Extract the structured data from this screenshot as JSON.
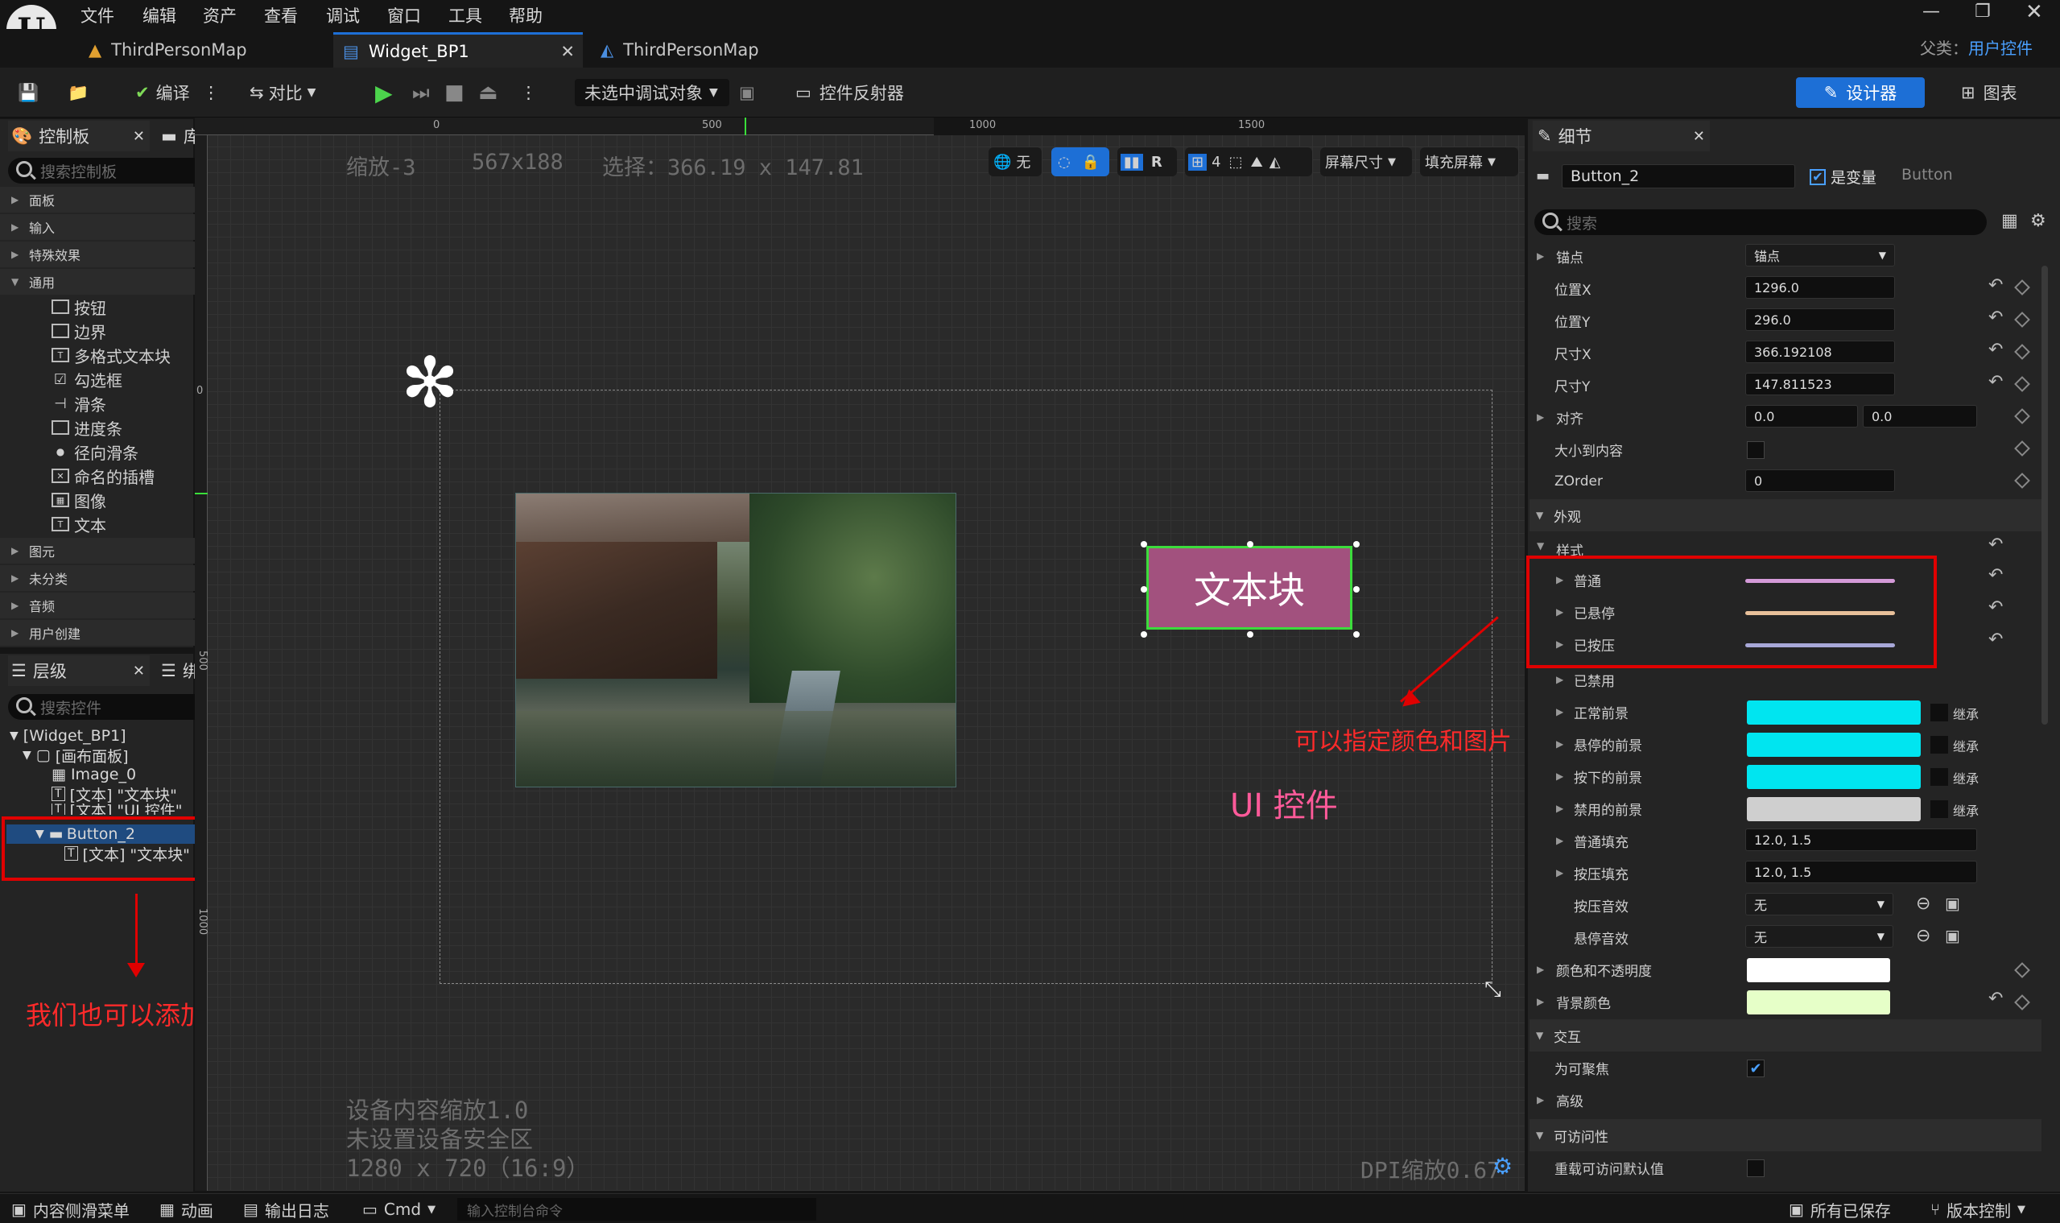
{
  "menu": [
    "文件",
    "编辑",
    "资产",
    "查看",
    "调试",
    "窗口",
    "工具",
    "帮助"
  ],
  "logo": "U",
  "tabs": [
    {
      "label": "ThirdPersonMap"
    },
    {
      "label": "Widget_BP1"
    },
    {
      "label": "ThirdPersonMap"
    }
  ],
  "parent_class": {
    "label": "父类：",
    "value": "用户控件"
  },
  "toolbar": {
    "compile": "编译",
    "diff": "对比",
    "debug_target": "未选中调试对象",
    "widget_reflector": "控件反射器",
    "designer": "设计器",
    "graph": "图表"
  },
  "palette": {
    "title": "控制板",
    "library": "库",
    "search_placeholder": "搜索控制板",
    "categories": [
      "面板",
      "输入",
      "特殊效果",
      "通用"
    ],
    "common_items": [
      "按钮",
      "边界",
      "多格式文本块",
      "勾选框",
      "滑条",
      "进度条",
      "径向滑条",
      "命名的插槽",
      "图像",
      "文本"
    ],
    "more_categories": [
      "图元",
      "未分类",
      "音频",
      "用户创建"
    ]
  },
  "hierarchy": {
    "title": "层级",
    "bind": "绑定控件",
    "search_placeholder": "搜索控件",
    "rows": [
      "[Widget_BP1]",
      "[画布面板]",
      "Image_0",
      "[文本] \"文本块\"",
      "[文本] \"UI 控件\"",
      "Button_2",
      "[文本] \"文本块\""
    ]
  },
  "viewport": {
    "zoom": "缩放-3",
    "size": "567x188",
    "selection": "选择：366.19 x 147.81",
    "ruler_top": [
      "0",
      "500",
      "1000",
      "1500"
    ],
    "ruler_left": [
      "0",
      "500",
      "1000"
    ],
    "tools": {
      "none": "无",
      "r": "R",
      "grid": "4",
      "screen_size": "屏幕尺寸",
      "fill_screen": "填充屏幕"
    },
    "button_text": "文本块",
    "ui_text": "UI 控件",
    "device_scale": "设备内容缩放1.0",
    "safe_zone": "未设置设备安全区",
    "resolution": "1280 x 720（16:9）",
    "dpi": "DPI缩放0.67"
  },
  "details": {
    "title": "细节",
    "name": "Button_2",
    "is_variable": "是变量",
    "class": "Button",
    "search_placeholder": "搜索",
    "anchor": {
      "label": "锚点",
      "value": "锚点"
    },
    "position_x": {
      "label": "位置X",
      "value": "1296.0"
    },
    "position_y": {
      "label": "位置Y",
      "value": "296.0"
    },
    "size_x": {
      "label": "尺寸X",
      "value": "366.192108"
    },
    "size_y": {
      "label": "尺寸Y",
      "value": "147.811523"
    },
    "alignment": {
      "label": "对齐",
      "v1": "0.0",
      "v2": "0.0"
    },
    "size_to_content": "大小到内容",
    "zorder": {
      "label": "ZOrder",
      "value": "0"
    },
    "appearance": "外观",
    "style": "样式",
    "normal": "普通",
    "hovered": "已悬停",
    "pressed": "已按压",
    "disabled": "已禁用",
    "normal_fg": "正常前景",
    "hovered_fg": "悬停的前景",
    "pressed_fg": "按下的前景",
    "disabled_fg": "禁用的前景",
    "inherit": "继承",
    "normal_padding": {
      "label": "普通填充",
      "value": "12.0, 1.5"
    },
    "pressed_padding": {
      "label": "按压填充",
      "value": "12.0, 1.5"
    },
    "pressed_sound": {
      "label": "按压音效",
      "value": "无"
    },
    "hovered_sound": {
      "label": "悬停音效",
      "value": "无"
    },
    "color_opacity": "颜色和不透明度",
    "bg_color": "背景颜色",
    "interaction": "交互",
    "focusable": "为可聚焦",
    "advanced": "高级",
    "accessibility": "可访问性",
    "override_access": "重载可访问默认值"
  },
  "colors": {
    "accent": "#1d6fd6",
    "cyan": "#00e5f0",
    "normal_line": "#d49ad8",
    "hovered_line": "#e8c09a",
    "pressed_line": "#a8a8d8",
    "button_fill": "#a2517e",
    "color_opacity": "#ffffff",
    "bg_color": "#e6ffc8",
    "annotation": "#ff2a2a"
  },
  "annotations": {
    "colors_images": "可以指定颜色和图片",
    "child_widgets": "我们也可以添加子控件"
  },
  "statusbar": {
    "content_drawer": "内容侧滑菜单",
    "animation": "动画",
    "output_log": "输出日志",
    "cmd": "Cmd",
    "cmd_placeholder": "输入控制台命令",
    "all_saved": "所有已保存",
    "source_control": "版本控制"
  }
}
